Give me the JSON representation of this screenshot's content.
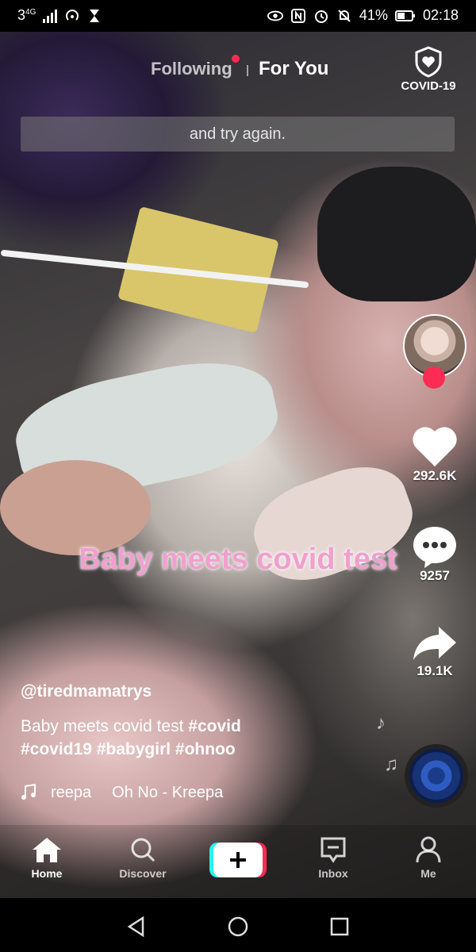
{
  "status_bar": {
    "network": "3",
    "network_type": "4G",
    "battery": "41%",
    "time": "02:18"
  },
  "top_nav": {
    "following": "Following",
    "for_you": "For You",
    "covid_badge": "COVID-19"
  },
  "video": {
    "caption_box": "and try again.",
    "overlay_text": "Baby meets covid test"
  },
  "right_rail": {
    "likes": "292.6K",
    "comments": "9257",
    "shares": "19.1K",
    "follow_icon": "plus"
  },
  "post": {
    "username": "@tiredmamatrys",
    "description_plain": "Baby meets covid test ",
    "description_tags_line1": "#covid",
    "description_tags_line2": "#covid19 #babygirl #ohnoo",
    "sound_artist": "reepa",
    "sound_title": "Oh No - Kreepa"
  },
  "bottom_nav": {
    "home": "Home",
    "discover": "Discover",
    "inbox": "Inbox",
    "me": "Me",
    "create_icon": "+"
  },
  "colors": {
    "accent": "#fe2c55",
    "overlay_text": "#f0a0cf",
    "cyan_edge": "#25f4ee"
  }
}
